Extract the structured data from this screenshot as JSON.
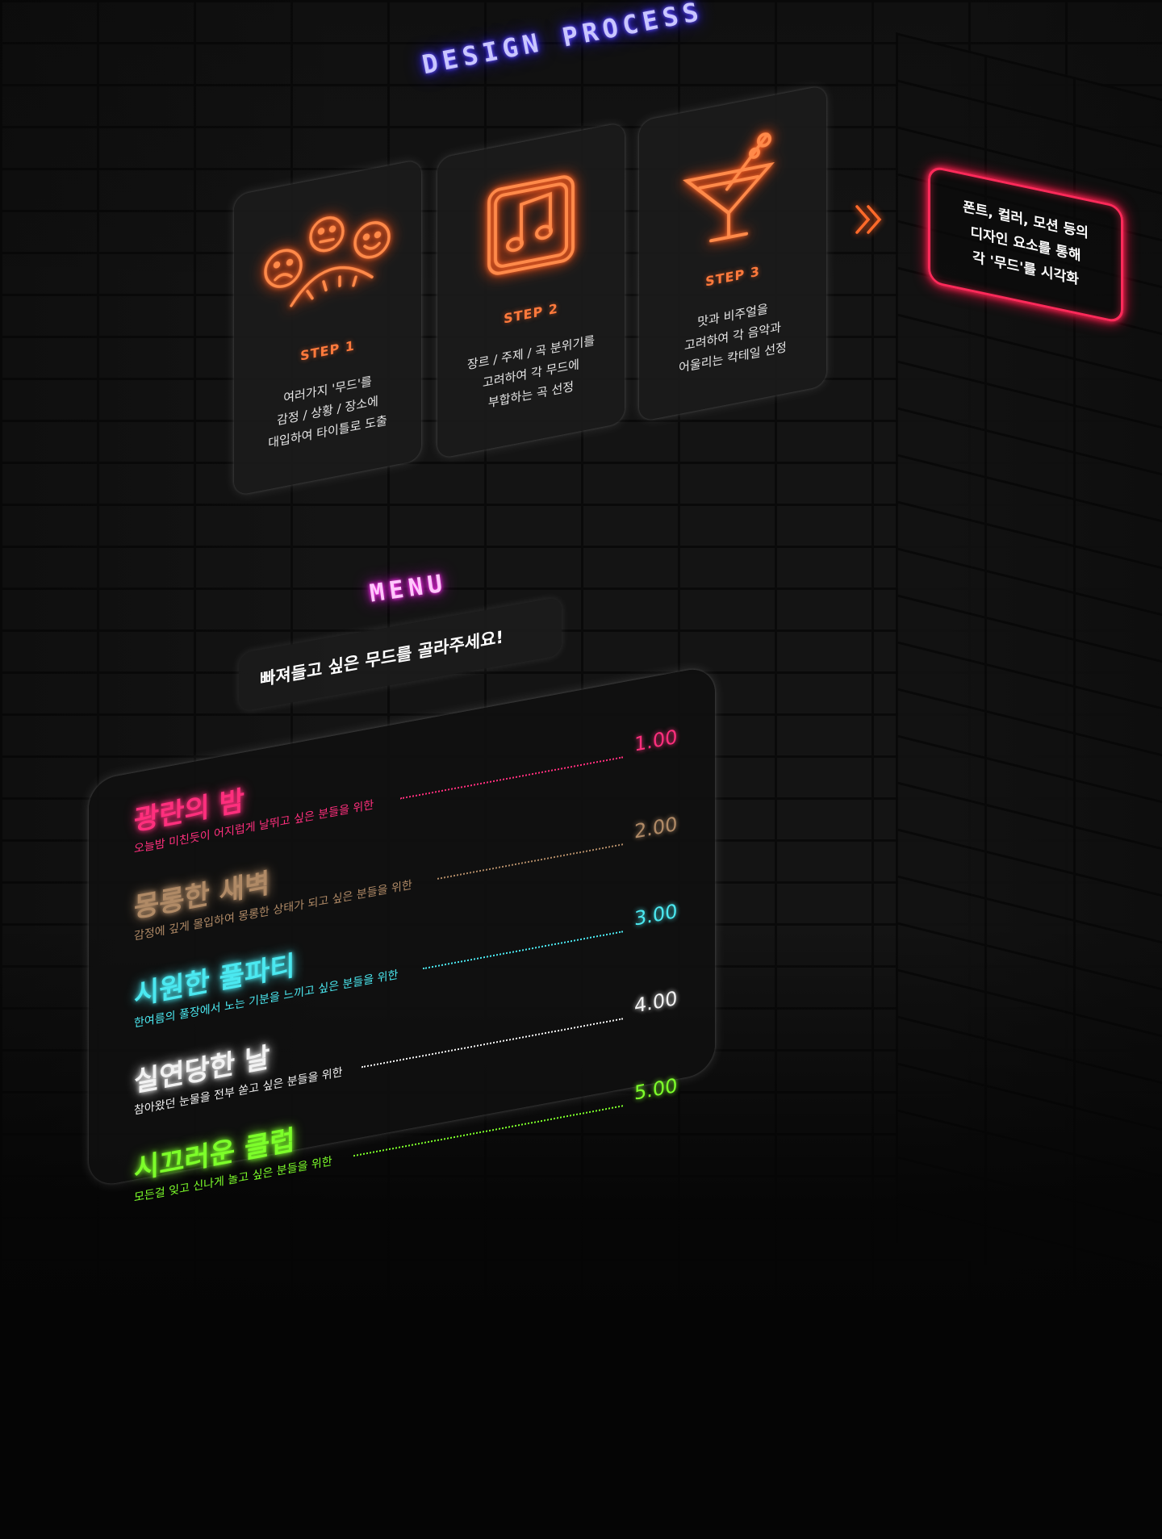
{
  "design_process": {
    "heading": "DESIGN PROCESS",
    "steps": [
      {
        "label": "STEP 1",
        "description": "여러가지 '무드'를\n감정 / 상황 / 장소에\n대입하여 타이틀로 도출",
        "icon": "mood-faces-icon"
      },
      {
        "label": "STEP 2",
        "description": "장르 / 주제 / 곡 분위기를\n고려하여 각 무드에\n부합하는 곡 선정",
        "icon": "music-note-icon"
      },
      {
        "label": "STEP 3",
        "description": "맛과 비주얼을\n고려하여 각 음악과\n어울리는 칵테일 선정",
        "icon": "cocktail-icon"
      }
    ],
    "arrow_icon": "double-chevron-right-icon",
    "result": "폰트, 컬러, 모션 등의\n디자인 요소를 통해\n각 '무드'를 시각화"
  },
  "menu": {
    "heading": "MENU",
    "prompt": "빠져들고 싶은 무드를 골라주세요!",
    "items": [
      {
        "name": "광란의 밤",
        "description": "오늘밤 미친듯이 어지럽게 날뛰고 싶은 분들을 위한",
        "price": "1.00",
        "color": "#ff2f7d"
      },
      {
        "name": "몽롱한 새벽",
        "description": "감정에 깊게 몰입하여 몽롱한 상태가 되고 싶은 분들을 위한",
        "price": "2.00",
        "color": "#b08a66"
      },
      {
        "name": "시원한 풀파티",
        "description": "한여름의 풀장에서 노는 기분을 느끼고 싶은 분들을 위한",
        "price": "3.00",
        "color": "#4be8f0"
      },
      {
        "name": "실연당한 날",
        "description": "참아왔던 눈물을 전부 쏟고 싶은 분들을 위한",
        "price": "4.00",
        "color": "#f2f2f2"
      },
      {
        "name": "시끄러운 클럽",
        "description": "모든걸 잊고 신나게 놀고 싶은 분들을 위한",
        "price": "5.00",
        "color": "#7dff2a"
      }
    ]
  },
  "colors": {
    "neon_orange": "#ff6a2a",
    "neon_blue": "#3c2cff",
    "neon_pink": "#ff3bf1",
    "neon_red": "#ff2a5a"
  }
}
